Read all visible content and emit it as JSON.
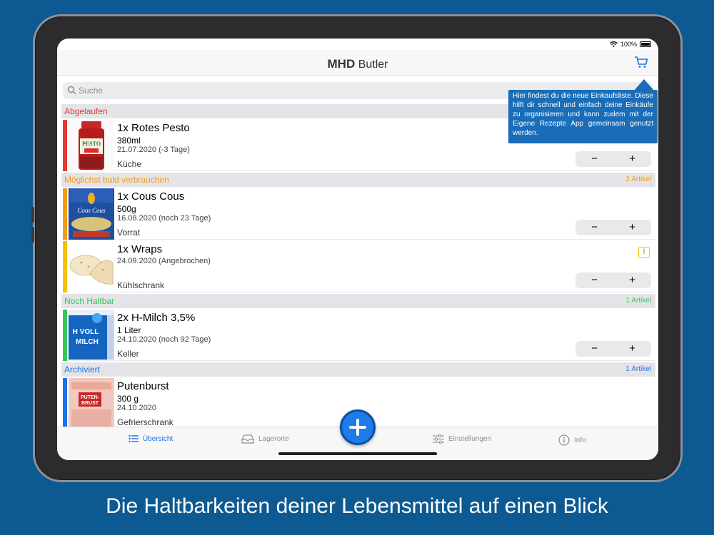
{
  "status": {
    "battery": "100%"
  },
  "nav": {
    "title_bold": "MHD",
    "title_rest": "Butler"
  },
  "search": {
    "placeholder": "Suche"
  },
  "tooltip": {
    "text": "Hier findest du die neue Einkaufsliste. Diese hilft dir schnell und einfach deine Einkäufe zu organisieren und kann zudem mit der Eigene Rezepte App gemeinsam genutzt werden."
  },
  "sections": {
    "expired": {
      "title": "Abgelaufen",
      "color": "#e53935"
    },
    "soon": {
      "title": "Möglichst bald verbrauchen",
      "count": "2 Artikel",
      "color": "#f39c12"
    },
    "ok": {
      "title": "Noch Haltbar",
      "count": "1 Artikel",
      "color": "#34c759"
    },
    "archived": {
      "title": "Archiviert",
      "count": "1 Artikel",
      "color": "#1a73e8"
    }
  },
  "items": [
    {
      "name": "1x Rotes Pesto",
      "amount": "380ml",
      "date": "21.07.2020 (-3 Tage)",
      "location": "Küche",
      "stripe": "#e53935"
    },
    {
      "name": "1x Cous Cous",
      "amount": "500g",
      "date": "16.08.2020 (noch 23 Tage)",
      "location": "Vorrat",
      "stripe": "#f39c12"
    },
    {
      "name": "1x Wraps",
      "date": "24.09.2020 (Angebrochen)",
      "location": "Kühlschrank",
      "stripe": "#f2c200",
      "warning": "!"
    },
    {
      "name": "2x H-Milch 3,5%",
      "amount": "1 Liter",
      "date": "24.10.2020 (noch 92 Tage)",
      "location": "Keller",
      "stripe": "#34c759"
    },
    {
      "name": "Putenburst",
      "amount": "300 g",
      "date": "24.10.2020",
      "location": "Gefrierschrank",
      "stripe": "#1a73e8"
    }
  ],
  "stepper": {
    "minus": "−",
    "plus": "+"
  },
  "thumb_labels": {
    "pesto": "PESTO",
    "couscous": "Cous Cous",
    "milk1": "H VOLL",
    "milk2": "MILCH",
    "pute1": "PUTEN-",
    "pute2": "BRUST"
  },
  "tabs": [
    {
      "label": "Übersicht",
      "icon": "list-icon",
      "active": true
    },
    {
      "label": "Lagerorte",
      "icon": "tray-icon"
    },
    {
      "label": "Einstellungen",
      "icon": "sliders-icon"
    },
    {
      "label": "Info",
      "icon": "info-icon"
    }
  ],
  "caption": "Die Haltbarkeiten deiner Lebensmittel auf einen Blick"
}
